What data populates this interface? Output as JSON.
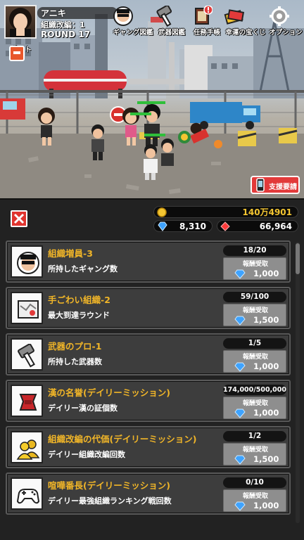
{
  "player": {
    "name": "アニキ",
    "org_line": "組織改編：1",
    "round": "ROUND 17"
  },
  "top_nav": [
    {
      "label": "ギャング図鑑",
      "icon": "gang-book-icon"
    },
    {
      "label": "武器図鑑",
      "icon": "hammer-icon"
    },
    {
      "label": "任務手帳",
      "icon": "mission-notebook-icon"
    },
    {
      "label": "幸運の宝くじ",
      "icon": "lottery-tickets-icon"
    },
    {
      "label": "オプション",
      "icon": "gear-icon"
    }
  ],
  "post_label": "ポスト",
  "support_label": "支援要請",
  "currency": {
    "gold": "140万4901",
    "gems": "8,310",
    "red_crystals": "66,964"
  },
  "reward_label": "報酬受取",
  "missions": [
    {
      "title": "組織増員-3",
      "desc": "所持したギャング数",
      "progress": "18/20",
      "reward": "1,000",
      "icon": "gangster-face-icon"
    },
    {
      "title": "手ごわい組織-2",
      "desc": "最大到達ラウンド",
      "progress": "59/100",
      "reward": "1,500",
      "icon": "map-icon"
    },
    {
      "title": "武器のプロ-1",
      "desc": "所持した武器数",
      "progress": "1/5",
      "reward": "1,000",
      "icon": "hammer-icon"
    },
    {
      "title": "漢の名誉(デイリーミッション)",
      "desc": "デイリー漢の証個数",
      "progress": "174,000/500,000",
      "reward": "1,000",
      "icon": "red-badge-icon"
    },
    {
      "title": "組織改編の代価(デイリーミッション)",
      "desc": "デイリー組織改編回数",
      "progress": "1/2",
      "reward": "1,500",
      "icon": "people-icon"
    },
    {
      "title": "喧嘩番長(デイリーミッション)",
      "desc": "デイリー最強組織ランキング戦回数",
      "progress": "0/10",
      "reward": "1,000",
      "icon": "gamepad-icon"
    }
  ],
  "colors": {
    "mission_title": "#f0b528",
    "gold": "#f3c531",
    "gem": "#3ea3ff",
    "red_crystal": "#ff3b3b",
    "close_button": "#e0352f"
  }
}
